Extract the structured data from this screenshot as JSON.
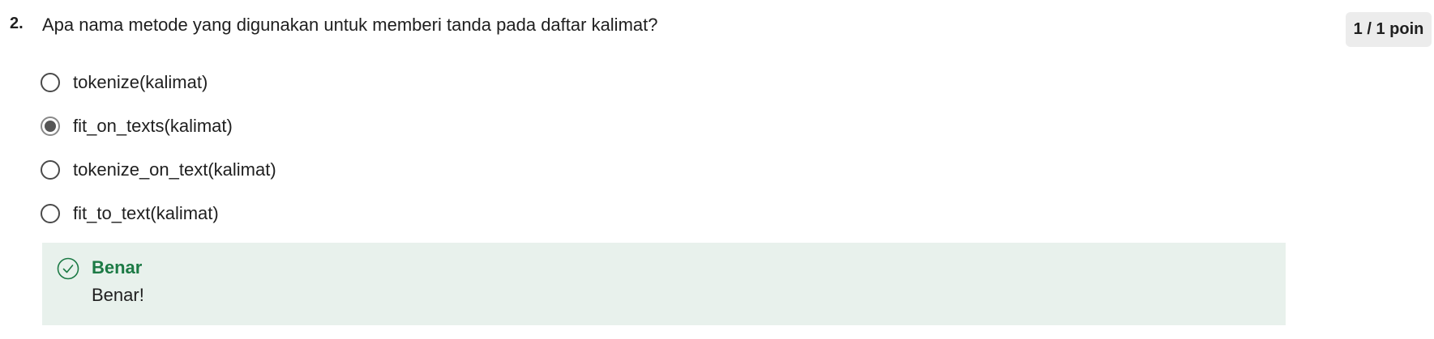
{
  "question": {
    "number": "2.",
    "text": "Apa nama metode yang digunakan untuk memberi tanda pada daftar kalimat?",
    "score": "1 / 1 poin"
  },
  "options": [
    {
      "label": "tokenize(kalimat)",
      "selected": false
    },
    {
      "label": "fit_on_texts(kalimat)",
      "selected": true
    },
    {
      "label": "tokenize_on_text(kalimat)",
      "selected": false
    },
    {
      "label": "fit_to_text(kalimat)",
      "selected": false
    }
  ],
  "feedback": {
    "icon": "check-circle-icon",
    "title": "Benar",
    "message": "Benar!",
    "accent_color": "#1c7a45",
    "background_color": "#e8f1ec"
  }
}
